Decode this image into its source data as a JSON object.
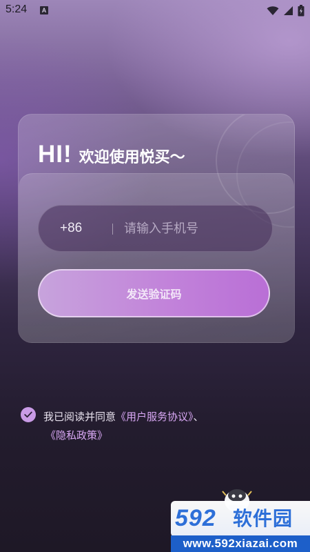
{
  "status_bar": {
    "time": "5:24",
    "notification_icon_letter": "A",
    "icons": [
      "wifi-icon",
      "cell-signal-icon",
      "battery-icon"
    ]
  },
  "login": {
    "greeting_hi": "HI!",
    "greeting_text": "欢迎使用悦买～",
    "country_code": "+86",
    "phone_placeholder": "请输入手机号",
    "phone_value": "",
    "send_code_label": "发送验证码"
  },
  "agreement": {
    "checked": true,
    "prefix": "我已阅读并同意",
    "user_agreement": "《用户服务协议》",
    "separator": "、",
    "privacy_policy": "《隐私政策》"
  },
  "watermark": {
    "number": "592",
    "brand": "软件园",
    "url": "www.592xiazai.com"
  },
  "colors": {
    "accent": "#c283da",
    "link": "#d9a8f5",
    "checkbox": "#c99be6",
    "watermark_blue": "#2d6fd8"
  }
}
